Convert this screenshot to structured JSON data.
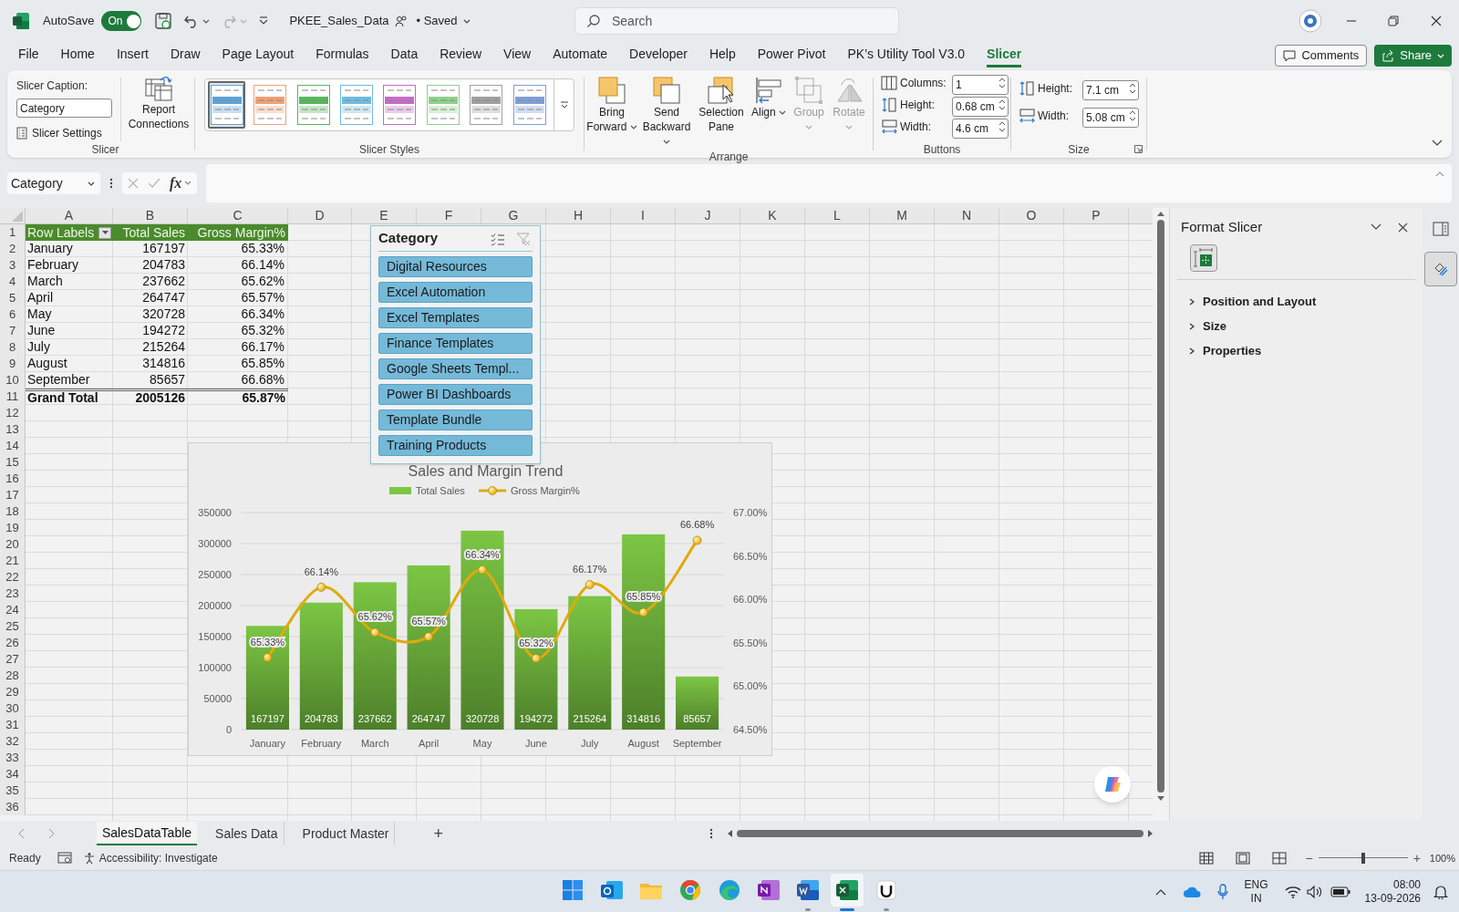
{
  "title_bar": {
    "autosave_label": "AutoSave",
    "autosave": {
      "label": "On",
      "on": true
    },
    "file_name": "PKEE_Sales_Data",
    "save_state": "• Saved",
    "search": {
      "placeholder": "Search"
    }
  },
  "menu_tabs": [
    {
      "label": "File",
      "selected": false
    },
    {
      "label": "Home",
      "selected": false
    },
    {
      "label": "Insert",
      "selected": false
    },
    {
      "label": "Draw",
      "selected": false
    },
    {
      "label": "Page Layout",
      "selected": false
    },
    {
      "label": "Formulas",
      "selected": false
    },
    {
      "label": "Data",
      "selected": false
    },
    {
      "label": "Review",
      "selected": false
    },
    {
      "label": "View",
      "selected": false
    },
    {
      "label": "Automate",
      "selected": false
    },
    {
      "label": "Developer",
      "selected": false
    },
    {
      "label": "Help",
      "selected": false
    },
    {
      "label": "Power Pivot",
      "selected": false
    },
    {
      "label": "PK’s Utility Tool V3.0",
      "selected": false
    },
    {
      "label": "Slicer",
      "selected": true
    }
  ],
  "comments_button": "Comments",
  "share_button": "Share",
  "ribbon": {
    "slicer_group": {
      "caption_label": "Slicer Caption:",
      "caption_value": "Category",
      "settings_button": "Slicer Settings",
      "report_button": "Report Connections",
      "label": "Slicer"
    },
    "styles_group": {
      "label": "Slicer Styles",
      "styles": [
        {
          "color": "#5da3d6",
          "selected": true
        },
        {
          "color": "#f0a074",
          "selected": false
        },
        {
          "color": "#55b85a",
          "selected": false
        },
        {
          "color": "#6fbbe0",
          "selected": false
        },
        {
          "color": "#c66bc6",
          "selected": false
        },
        {
          "color": "#8fd08a",
          "selected": false
        },
        {
          "color": "#a0a0a0",
          "selected": false
        },
        {
          "color": "#7f9fd6",
          "selected": false
        }
      ]
    },
    "arrange_group": {
      "label": "Arrange",
      "buttons": [
        {
          "kind": "bring_forward",
          "label": "Bring Forward",
          "dropdown": true,
          "disabled": false
        },
        {
          "kind": "send_backward",
          "label": "Send Backward",
          "dropdown": true,
          "disabled": false
        },
        {
          "kind": "selection_pane",
          "label": "Selection Pane",
          "dropdown": false,
          "disabled": false
        },
        {
          "kind": "align",
          "label": "Align",
          "dropdown": true,
          "disabled": false
        },
        {
          "kind": "group",
          "label": "Group",
          "dropdown": true,
          "disabled": true
        },
        {
          "kind": "rotate",
          "label": "Rotate",
          "dropdown": true,
          "disabled": true
        }
      ]
    },
    "buttons_group": {
      "label": "Buttons",
      "fields": [
        {
          "kind": "columns",
          "label": "Columns:",
          "value": "1"
        },
        {
          "kind": "height",
          "label": "Height:",
          "value": "0.68 cm"
        },
        {
          "kind": "width",
          "label": "Width:",
          "value": "4.6 cm"
        }
      ]
    },
    "size_group": {
      "label": "Size",
      "fields": [
        {
          "kind": "height",
          "label": "Height:",
          "value": "7.1 cm"
        },
        {
          "kind": "width",
          "label": "Width:",
          "value": "5.08 cm"
        }
      ]
    }
  },
  "formula_bar": {
    "name_box": "Category",
    "fx": "fx"
  },
  "sheet": {
    "columns": [
      "A",
      "B",
      "C",
      "D",
      "E",
      "F",
      "G",
      "H",
      "I",
      "J",
      "K",
      "L",
      "M",
      "N",
      "O",
      "P"
    ],
    "rows": [
      "1",
      "2",
      "3",
      "4",
      "5",
      "6",
      "7",
      "8",
      "9",
      "10",
      "11",
      "12",
      "13",
      "14",
      "15",
      "16",
      "17",
      "18",
      "19",
      "20",
      "21",
      "22",
      "23",
      "24",
      "25",
      "26",
      "27",
      "28",
      "29",
      "30",
      "31",
      "32",
      "33",
      "34",
      "35",
      "36"
    ]
  },
  "pivot": {
    "headers": [
      "Row Labels",
      "Total Sales",
      "Gross Margin%"
    ],
    "rows": [
      [
        "January",
        "167197",
        "65.33%"
      ],
      [
        "February",
        "204783",
        "66.14%"
      ],
      [
        "March",
        "237662",
        "65.62%"
      ],
      [
        "April",
        "264747",
        "65.57%"
      ],
      [
        "May",
        "320728",
        "66.34%"
      ],
      [
        "June",
        "194272",
        "65.32%"
      ],
      [
        "July",
        "215264",
        "66.17%"
      ],
      [
        "August",
        "314816",
        "65.85%"
      ],
      [
        "September",
        "85657",
        "66.68%"
      ]
    ],
    "total": [
      "Grand Total",
      "2005126",
      "65.87%"
    ]
  },
  "slicer": {
    "title": "Category",
    "items": [
      {
        "label": "Digital Resources",
        "selected": true
      },
      {
        "label": "Excel Automation",
        "selected": true
      },
      {
        "label": "Excel Templates",
        "selected": true
      },
      {
        "label": "Finance Templates",
        "selected": true
      },
      {
        "label": "Google Sheets Templ...",
        "selected": true
      },
      {
        "label": "Power BI Dashboards",
        "selected": true
      },
      {
        "label": "Template Bundle",
        "selected": true
      },
      {
        "label": "Training Products",
        "selected": true
      }
    ]
  },
  "chart": {
    "chart_data": {
      "type": "bar",
      "title": "Sales and Margin Trend",
      "categories": [
        "January",
        "February",
        "March",
        "April",
        "May",
        "June",
        "July",
        "August",
        "September"
      ],
      "series": [
        {
          "name": "Total Sales",
          "color": "#7cc644",
          "values": [
            167197,
            204783,
            237662,
            264747,
            320728,
            194272,
            215264,
            314816,
            85657
          ],
          "value_labels": [
            "167197",
            "204783",
            "237662",
            "264747",
            "320728",
            "194272",
            "215264",
            "314816",
            "85657"
          ]
        },
        {
          "name": "Gross Margin%",
          "color": "#e0aa0c",
          "type": "line",
          "axis": "y2",
          "marker": "circle",
          "values": [
            65.33,
            66.14,
            65.62,
            65.57,
            66.34,
            65.32,
            66.17,
            65.85,
            66.68
          ],
          "value_labels": [
            "65.33%",
            "66.14%",
            "65.62%",
            "65.57%",
            "66.34%",
            "65.32%",
            "66.17%",
            "65.85%",
            "66.68%"
          ]
        }
      ],
      "grid": true,
      "legend": true,
      "ylim": [
        0,
        350000
      ],
      "yticks": [
        0,
        50000,
        100000,
        150000,
        200000,
        250000,
        300000,
        350000
      ],
      "y2lim": [
        64.5,
        67
      ],
      "y2ticks": [
        {
          "value": 64.5,
          "label": "64.50%"
        },
        {
          "value": 65,
          "label": "65.00%"
        },
        {
          "value": 65.5,
          "label": "65.50%"
        },
        {
          "value": 66,
          "label": "66.00%"
        },
        {
          "value": 66.5,
          "label": "66.50%"
        },
        {
          "value": 67,
          "label": "67.00%"
        }
      ]
    }
  },
  "format_pane": {
    "title": "Format Slicer",
    "icon_tabs": [
      {
        "kind": "size",
        "selected": true
      }
    ],
    "sections": [
      {
        "label": "Position and Layout",
        "expanded": false
      },
      {
        "label": "Size",
        "expanded": false
      },
      {
        "label": "Properties",
        "expanded": false
      }
    ]
  },
  "side_strip": [
    {
      "kind": "pane",
      "selected": false
    },
    {
      "kind": "format",
      "selected": true
    }
  ],
  "sheet_tabs": [
    {
      "label": "SalesDataTable",
      "selected": true
    },
    {
      "label": "Sales Data",
      "selected": false
    },
    {
      "label": "Product Master",
      "selected": false
    }
  ],
  "add_sheet": "+",
  "status_bar": {
    "ready": "Ready",
    "accessibility": "Accessibility: Investigate",
    "zoom_out": "−",
    "zoom_in": "+",
    "zoom": {
      "level": 0.5,
      "reading": "100%"
    }
  },
  "taskbar": {
    "apps": [
      {
        "kind": "start",
        "running": false,
        "active": false
      },
      {
        "kind": "mail",
        "running": false,
        "active": false
      },
      {
        "kind": "folder",
        "running": false,
        "active": false
      },
      {
        "kind": "chrome",
        "running": false,
        "active": false
      },
      {
        "kind": "edge",
        "running": false,
        "active": false
      },
      {
        "kind": "notes",
        "running": false,
        "active": false
      },
      {
        "kind": "word",
        "running": true,
        "active": false
      },
      {
        "kind": "excel",
        "running": true,
        "active": true
      },
      {
        "kind": "utility",
        "running": true,
        "active": false
      }
    ],
    "language": "ENG",
    "region": "IN",
    "time": "08:00",
    "date": "13-09-2026"
  }
}
